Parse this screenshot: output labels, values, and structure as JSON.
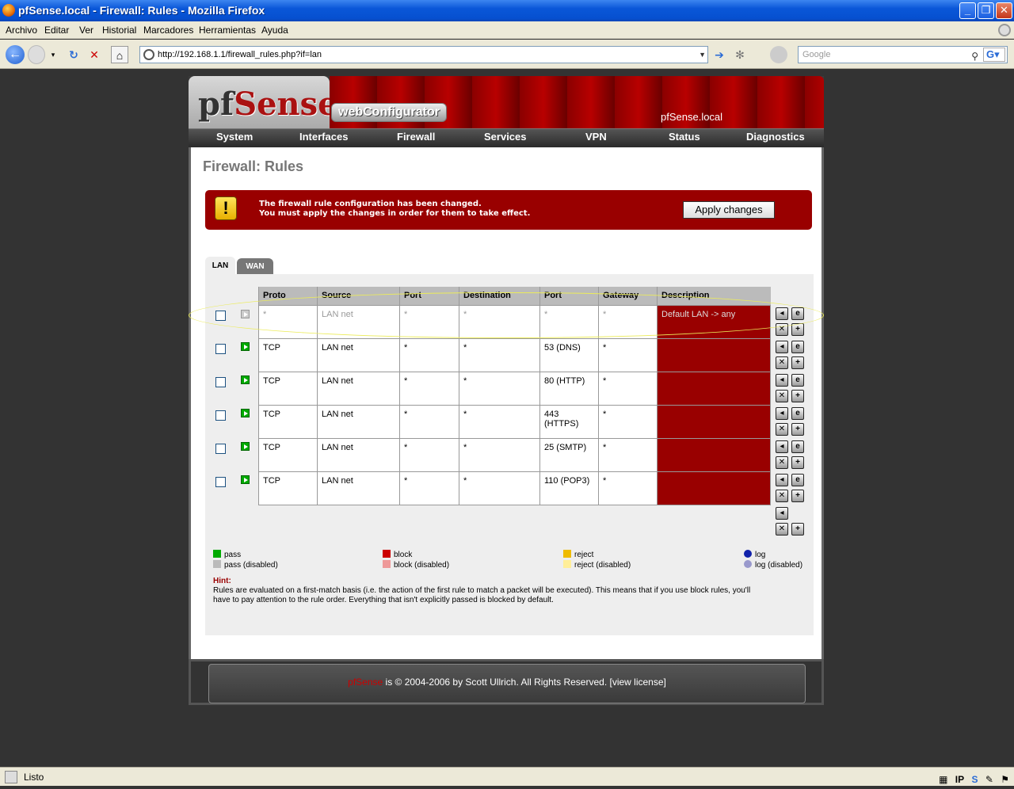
{
  "window": {
    "title": "pfSense.local - Firewall: Rules - Mozilla Firefox"
  },
  "menu": [
    "Archivo",
    "Editar",
    "Ver",
    "Historial",
    "Marcadores",
    "Herramientas",
    "Ayuda"
  ],
  "navbar": {
    "url": "http://192.168.1.1/firewall_rules.php?if=lan",
    "search_placeholder": "Google"
  },
  "header": {
    "logo_pf": "pf",
    "logo_sense": "Sense",
    "webconfig": "webConfigurator",
    "hostname": "pfSense.local"
  },
  "nav": [
    "System",
    "Interfaces",
    "Firewall",
    "Services",
    "VPN",
    "Status",
    "Diagnostics"
  ],
  "page_title": "Firewall: Rules",
  "alert": {
    "line1": "The firewall rule configuration has been changed.",
    "line2": "You must apply the changes in order for them to take effect.",
    "button": "Apply changes"
  },
  "tabs": [
    "LAN",
    "WAN"
  ],
  "table": {
    "headers": [
      "Proto",
      "Source",
      "Port",
      "Destination",
      "Port",
      "Gateway",
      "Description"
    ],
    "rows": [
      {
        "proto": "*",
        "source": "LAN net",
        "sport": "*",
        "dest": "*",
        "dport": "*",
        "gateway": "*",
        "desc": "Default LAN -> any"
      },
      {
        "proto": "TCP",
        "source": "LAN net",
        "sport": "*",
        "dest": "*",
        "dport": "53 (DNS)",
        "gateway": "*",
        "desc": ""
      },
      {
        "proto": "TCP",
        "source": "LAN net",
        "sport": "*",
        "dest": "*",
        "dport": "80 (HTTP)",
        "gateway": "*",
        "desc": ""
      },
      {
        "proto": "TCP",
        "source": "LAN net",
        "sport": "*",
        "dest": "*",
        "dport": "443 (HTTPS)",
        "gateway": "*",
        "desc": ""
      },
      {
        "proto": "TCP",
        "source": "LAN net",
        "sport": "*",
        "dest": "*",
        "dport": "25 (SMTP)",
        "gateway": "*",
        "desc": ""
      },
      {
        "proto": "TCP",
        "source": "LAN net",
        "sport": "*",
        "dest": "*",
        "dport": "110 (POP3)",
        "gateway": "*",
        "desc": ""
      }
    ]
  },
  "legend": {
    "pass": "pass",
    "pass_dis": "pass (disabled)",
    "block": "block",
    "block_dis": "block (disabled)",
    "reject": "reject",
    "reject_dis": "reject (disabled)",
    "log": "log",
    "log_dis": "log (disabled)"
  },
  "hint": {
    "label": "Hint:",
    "text": "Rules are evaluated on a first-match basis (i.e. the action of the first rule to match a packet will be executed). This means that if you use block rules, you'll have to pay attention to the rule order. Everything that isn't explicitly passed is blocked by default."
  },
  "footer": {
    "brand": "pfSense",
    "text": " is © 2004-2006 by Scott Ullrich. All Rights Reserved. [view license]"
  },
  "status": {
    "text": "Listo",
    "ip": "IP",
    "s": "S"
  },
  "colors": {
    "accent_red": "#990000",
    "pass_green": "#00aa00",
    "titlebar_blue": "#0a57d8"
  }
}
